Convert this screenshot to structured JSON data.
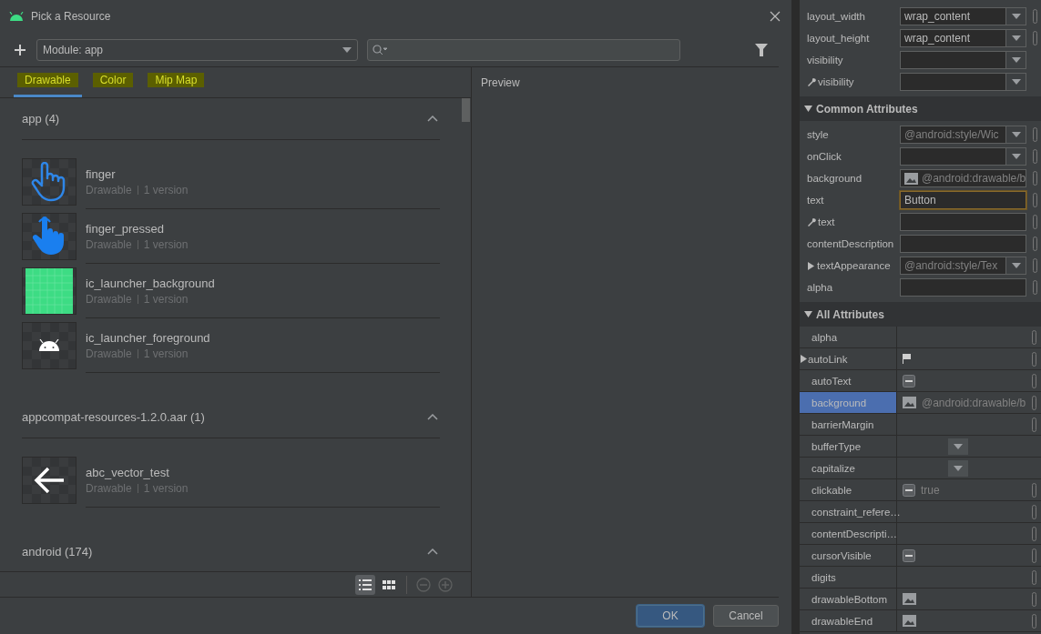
{
  "dialog": {
    "title": "Pick a Resource",
    "module": "Module: app",
    "tabs": [
      {
        "label": "Drawable",
        "selected": true,
        "highlighted": true
      },
      {
        "label": "Color",
        "selected": false,
        "highlighted": true
      },
      {
        "label": "Mip Map",
        "selected": false,
        "highlighted": true
      }
    ],
    "sections": [
      {
        "title": "app (4)",
        "expanded": true,
        "items": [
          {
            "name": "finger",
            "type": "Drawable",
            "versions": "1 version",
            "kind": "hand-outline"
          },
          {
            "name": "finger_pressed",
            "type": "Drawable",
            "versions": "1 version",
            "kind": "hand-filled"
          },
          {
            "name": "ic_launcher_background",
            "type": "Drawable",
            "versions": "1 version",
            "kind": "green-grid"
          },
          {
            "name": "ic_launcher_foreground",
            "type": "Drawable",
            "versions": "1 version",
            "kind": "android-head"
          }
        ]
      },
      {
        "title": "appcompat-resources-1.2.0.aar (1)",
        "expanded": true,
        "items": [
          {
            "name": "abc_vector_test",
            "type": "Drawable",
            "versions": "1 version",
            "kind": "arrow-left"
          }
        ]
      },
      {
        "title": "android (174)",
        "expanded": true
      }
    ],
    "view_buttons": [
      {
        "kind": "list",
        "selected": true
      },
      {
        "kind": "grid",
        "selected": false
      }
    ],
    "preview_title": "Preview",
    "buttons": [
      {
        "label": "OK",
        "default": true
      },
      {
        "label": "Cancel",
        "default": false
      }
    ]
  },
  "attributes": {
    "top_rows": [
      {
        "label": "layout_width",
        "kind": "dropdown",
        "value": "wrap_content",
        "inherited": false,
        "wrench": false,
        "pin": true
      },
      {
        "label": "layout_height",
        "kind": "dropdown",
        "value": "wrap_content",
        "inherited": false,
        "wrench": false,
        "pin": true
      },
      {
        "label": "visibility",
        "kind": "dropdown",
        "wrench": false,
        "pin": false
      },
      {
        "label": "visibility",
        "kind": "dropdown",
        "wrench": true,
        "pin": false
      }
    ],
    "common": {
      "title": "Common Attributes",
      "expanded": true,
      "rows": [
        {
          "label": "style",
          "kind": "dropdown",
          "value": "@android:style/Wic",
          "inherited": true,
          "wrench": false,
          "pin": true
        },
        {
          "label": "onClick",
          "kind": "dropdown",
          "wrench": false,
          "pin": true
        },
        {
          "label": "background",
          "kind": "image",
          "value": "@android:drawable/b",
          "inherited": true,
          "wrench": false,
          "pin": true
        },
        {
          "label": "text",
          "kind": "text",
          "value": "Button",
          "inherited": false,
          "focused": true,
          "wrench": false,
          "pin": true
        },
        {
          "label": "text",
          "kind": "text",
          "wrench": true,
          "pin": true
        },
        {
          "label": "contentDescription",
          "kind": "text",
          "wrench": false,
          "pin": true
        },
        {
          "label": "textAppearance",
          "kind": "dropdown",
          "value": "@android:style/Tex",
          "inherited": true,
          "expandable": true,
          "wrench": false,
          "pin": true
        },
        {
          "label": "alpha",
          "kind": "text",
          "wrench": false,
          "pin": true
        }
      ]
    },
    "all": {
      "title": "All Attributes",
      "expanded": true,
      "rows": [
        {
          "label": "alpha",
          "kind": "empty",
          "selected": false,
          "pin": true
        },
        {
          "label": "autoLink",
          "kind": "flag",
          "selected": false,
          "expandable": true,
          "pin": true
        },
        {
          "label": "autoText",
          "kind": "checkbox",
          "selected": false,
          "pin": true
        },
        {
          "label": "background",
          "kind": "image",
          "value": "@android:drawable/b",
          "selected": true,
          "pin": true
        },
        {
          "label": "barrierMargin",
          "kind": "empty",
          "selected": false,
          "pin": true
        },
        {
          "label": "bufferType",
          "kind": "dropdown",
          "selected": false,
          "pin": false
        },
        {
          "label": "capitalize",
          "kind": "dropdown",
          "selected": false,
          "pin": false
        },
        {
          "label": "clickable",
          "kind": "checkbox",
          "value": "true",
          "selected": false,
          "pin": true
        },
        {
          "label": "constraint_refere…",
          "kind": "empty",
          "selected": false,
          "pin": true
        },
        {
          "label": "contentDescripti…",
          "kind": "empty",
          "selected": false,
          "pin": true
        },
        {
          "label": "cursorVisible",
          "kind": "checkbox",
          "selected": false,
          "pin": true
        },
        {
          "label": "digits",
          "kind": "empty",
          "selected": false,
          "pin": true
        },
        {
          "label": "drawableBottom",
          "kind": "image",
          "selected": false,
          "pin": true
        },
        {
          "label": "drawableEnd",
          "kind": "image",
          "selected": false,
          "pin": true
        }
      ]
    }
  }
}
